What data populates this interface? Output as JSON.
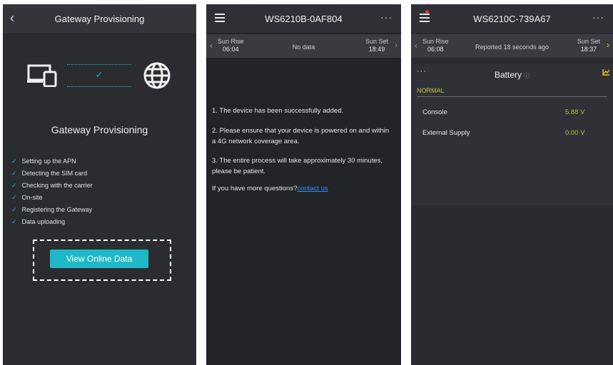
{
  "panel1": {
    "title": "Gateway Provisioning",
    "subtitle": "Gateway Provisioning",
    "steps": [
      "Setting up the APN",
      "Detecting the SIM card",
      "Checking with the carrier",
      "On-site",
      "Registering the Gateway",
      "Data uploading"
    ],
    "button_label": "View Online Data",
    "accent_color": "#1fb8c8"
  },
  "panel2": {
    "title": "WS6210B-0AF804",
    "sun_rise_label": "Sun Rise",
    "sun_rise_time": "06:04",
    "sun_set_label": "Sun Set",
    "sun_set_time": "18:49",
    "status": "No data",
    "messages": [
      "1. The device has been successfully added.",
      "2. Please ensure that your device is powered on and within a 4G network coverage area.",
      "3. The entire process will take approximately 30 minutes, please be patient."
    ],
    "question_text": "If you have more questions?",
    "link_text": "contact us",
    "link_color": "#2a8cf0"
  },
  "panel3": {
    "title": "WS6210C-739A67",
    "sun_rise_label": "Sun Rise",
    "sun_rise_time": "06:08",
    "sun_set_label": "Sun Set",
    "sun_set_time": "18:37",
    "status": "Reported 18 seconds ago",
    "card_title": "Battery",
    "state": "NORMAL",
    "rows": [
      {
        "label": "Console",
        "value": "5.88 V"
      },
      {
        "label": "External Supply",
        "value": "0.00 V"
      }
    ],
    "value_color": "#b6c23a"
  }
}
